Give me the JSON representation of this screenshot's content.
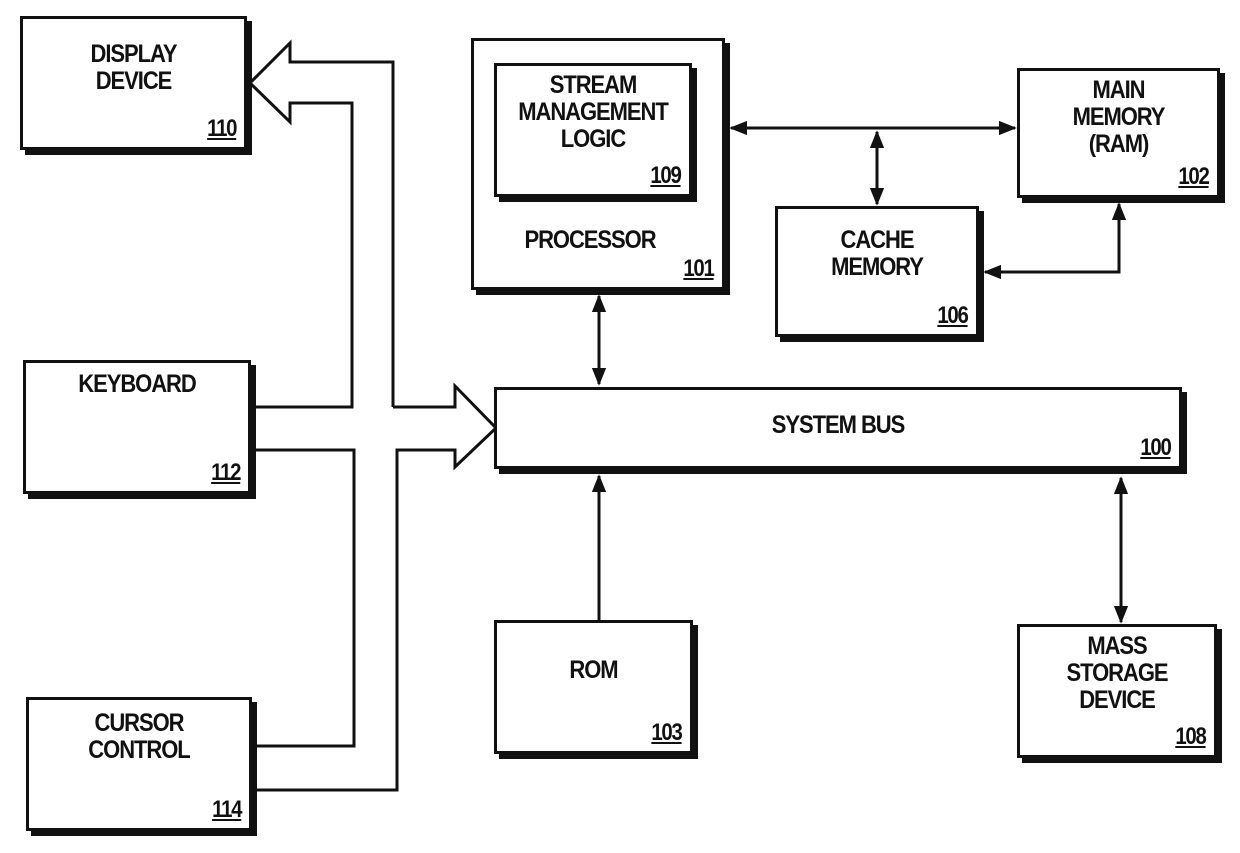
{
  "figure": {
    "type": "block-diagram",
    "components": {
      "display": {
        "label": "DISPLAY\nDEVICE",
        "ref": "110"
      },
      "keyboard": {
        "label": "KEYBOARD",
        "ref": "112"
      },
      "cursor": {
        "label": "CURSOR\nCONTROL",
        "ref": "114"
      },
      "processor": {
        "label": "PROCESSOR",
        "ref": "101"
      },
      "stream_logic": {
        "label": "STREAM\nMANAGEMENT\nLOGIC",
        "ref": "109"
      },
      "main_memory": {
        "label": "MAIN\nMEMORY\n(RAM)",
        "ref": "102"
      },
      "cache": {
        "label": "CACHE\nMEMORY",
        "ref": "106"
      },
      "bus": {
        "label": "SYSTEM BUS",
        "ref": "100"
      },
      "rom": {
        "label": "ROM",
        "ref": "103"
      },
      "mass_storage": {
        "label": "MASS\nSTORAGE\nDEVICE",
        "ref": "108"
      }
    },
    "connections": [
      {
        "from": "system-bus",
        "to": "display-device",
        "style": "hollow-wide-arrow"
      },
      {
        "from": "keyboard",
        "to": "system-bus",
        "style": "hollow-wide-arrow"
      },
      {
        "from": "cursor-control",
        "to": "system-bus",
        "style": "hollow-wide-arrow"
      },
      {
        "from": "processor",
        "to": "system-bus",
        "style": "bidirectional"
      },
      {
        "from": "processor",
        "to": "main-memory",
        "style": "bidirectional"
      },
      {
        "from": "processor-memory-link",
        "to": "cache-memory",
        "style": "bidirectional"
      },
      {
        "from": "cache-memory",
        "to": "main-memory",
        "style": "bidirectional"
      },
      {
        "from": "rom",
        "to": "system-bus",
        "style": "unidirectional"
      },
      {
        "from": "system-bus",
        "to": "mass-storage-device",
        "style": "bidirectional"
      }
    ]
  }
}
